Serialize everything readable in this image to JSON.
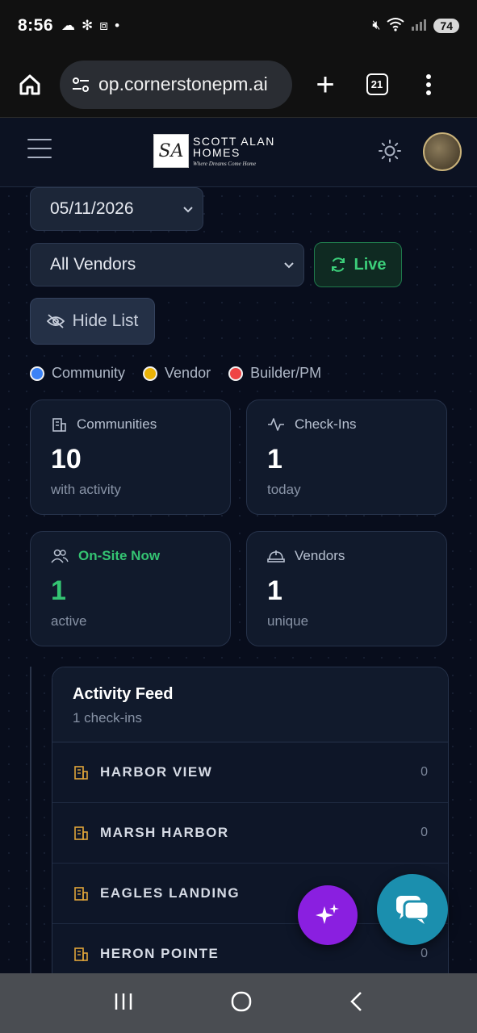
{
  "status": {
    "time": "8:56",
    "battery": "74",
    "signal_label": "6"
  },
  "browser": {
    "url": "op.cornerstonepm.ai",
    "tab_count": "21"
  },
  "brand": {
    "monogram": "SA",
    "line1": "SCOTT ALAN",
    "line2": "HOMES",
    "tagline": "Where Dreams Come Home"
  },
  "filters": {
    "date": "05/11/2026",
    "vendor": "All Vendors",
    "live_label": "Live",
    "hide_list_label": "Hide List"
  },
  "legend": [
    {
      "label": "Community",
      "color": "#3b82f6"
    },
    {
      "label": "Vendor",
      "color": "#eab308"
    },
    {
      "label": "Builder/PM",
      "color": "#ef4444"
    }
  ],
  "stats": {
    "communities": {
      "title": "Communities",
      "value": "10",
      "sub": "with activity"
    },
    "checkins": {
      "title": "Check-Ins",
      "value": "1",
      "sub": "today"
    },
    "onsite": {
      "title": "On-Site Now",
      "value": "1",
      "sub": "active"
    },
    "vendors": {
      "title": "Vendors",
      "value": "1",
      "sub": "unique"
    }
  },
  "feed": {
    "title": "Activity Feed",
    "subtitle": "1 check-ins",
    "rows": [
      {
        "name": "HARBOR VIEW",
        "count": "0"
      },
      {
        "name": "MARSH HARBOR",
        "count": "0"
      },
      {
        "name": "EAGLES LANDING",
        "count": "0"
      },
      {
        "name": "HERON POINTE",
        "count": "0"
      }
    ]
  }
}
